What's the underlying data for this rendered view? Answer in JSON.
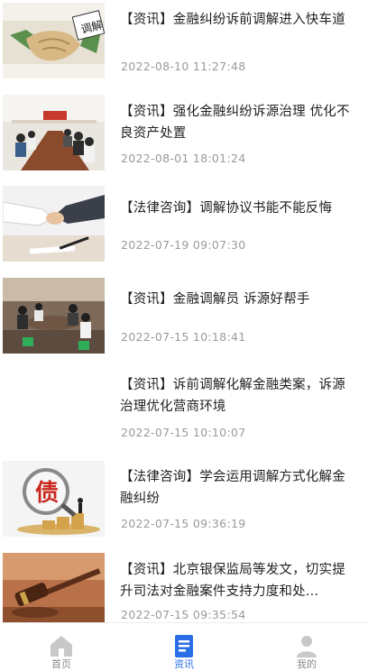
{
  "news": [
    {
      "title": "【资讯】金融纠纷诉前调解进入快车道",
      "date": "2022-08-10 11:27:48",
      "thumb": "handshake-mediation-image"
    },
    {
      "title": "【资讯】强化金融纠纷诉源治理 优化不良资产处置",
      "date": "2022-08-01 18:01:24",
      "thumb": "meeting-room-image"
    },
    {
      "title": "【法律咨询】调解协议书能不能反悔",
      "date": "2022-07-19 09:07:30",
      "thumb": "handshake-document-image"
    },
    {
      "title": "【资讯】金融调解员 诉源好帮手",
      "date": "2022-07-15 10:18:41",
      "thumb": "mediation-meeting-image"
    },
    {
      "title": "【资讯】诉前调解化解金融类案，诉源治理优化营商环境",
      "date": "2022-07-15 10:10:07",
      "thumb": ""
    },
    {
      "title": "【法律咨询】学会运用调解方式化解金融纠纷",
      "date": "2022-07-15 09:36:19",
      "thumb": "debt-magnifier-image"
    },
    {
      "title": "【资讯】北京银保监局等发文，切实提升司法对金融案件支持力度和处...",
      "date": "2022-07-15 09:35:54",
      "thumb": "gavel-image"
    }
  ],
  "tabbar": {
    "tabs": [
      {
        "label": "首页",
        "icon": "home-icon",
        "active": false
      },
      {
        "label": "资讯",
        "icon": "news-icon",
        "active": true
      },
      {
        "label": "我的",
        "icon": "person-icon",
        "active": false
      }
    ],
    "active_color": "#2b6fe6",
    "inactive_color": "#c8c8c8"
  },
  "image_text": {
    "mediation_sign": "调解",
    "debt_char": "债"
  }
}
